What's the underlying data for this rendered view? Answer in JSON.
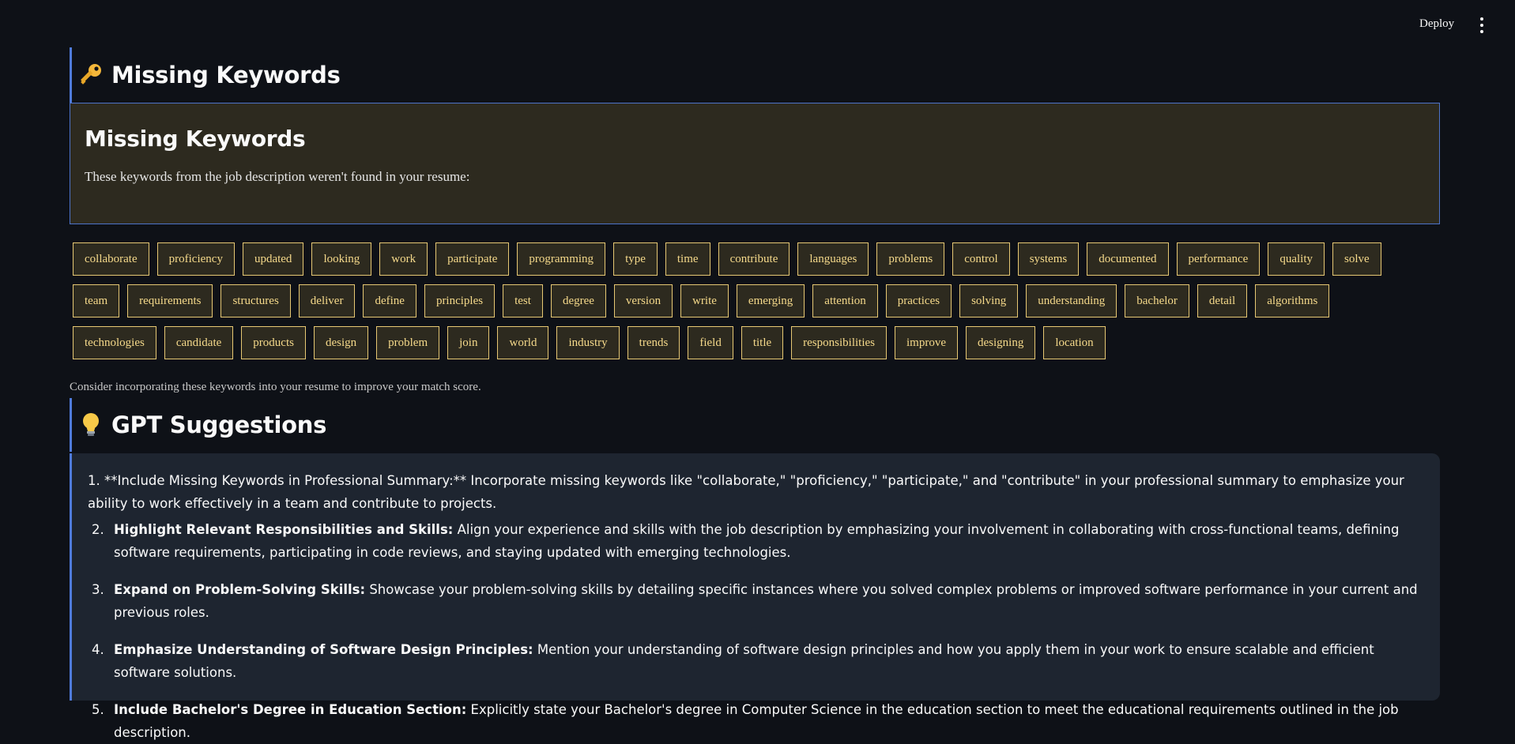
{
  "topbar": {
    "deploy_label": "Deploy",
    "menu_icon": "vertical-dots-icon"
  },
  "missing_section": {
    "emoji": "key-icon",
    "heading": "Missing Keywords",
    "box_title": "Missing Keywords",
    "box_text": "These keywords from the job description weren't found in your resume:",
    "keywords": [
      "collaborate",
      "proficiency",
      "updated",
      "looking",
      "work",
      "participate",
      "programming",
      "type",
      "time",
      "contribute",
      "languages",
      "problems",
      "control",
      "systems",
      "documented",
      "performance",
      "quality",
      "solve",
      "team",
      "requirements",
      "structures",
      "deliver",
      "define",
      "principles",
      "test",
      "degree",
      "version",
      "write",
      "emerging",
      "attention",
      "practices",
      "solving",
      "understanding",
      "bachelor",
      "detail",
      "algorithms",
      "technologies",
      "candidate",
      "products",
      "design",
      "problem",
      "join",
      "world",
      "industry",
      "trends",
      "field",
      "title",
      "responsibilities",
      "improve",
      "designing",
      "location"
    ],
    "footer": "Consider incorporating these keywords into your resume to improve your match score."
  },
  "gpt_section": {
    "emoji": "lightbulb-icon",
    "heading": "GPT Suggestions",
    "first": "1. **Include Missing Keywords in Professional Summary:** Incorporate missing keywords like \"collaborate,\" \"proficiency,\" \"participate,\" and \"contribute\" in your professional summary to emphasize your ability to work effectively in a team and contribute to projects.",
    "items": [
      {
        "num": "2.",
        "title": "Highlight Relevant Responsibilities and Skills:",
        "text": " Align your experience and skills with the job description by emphasizing your involvement in collaborating with cross-functional teams, defining software requirements, participating in code reviews, and staying updated with emerging technologies."
      },
      {
        "num": "3.",
        "title": "Expand on Problem-Solving Skills:",
        "text": " Showcase your problem-solving skills by detailing specific instances where you solved complex problems or improved software performance in your current and previous roles."
      },
      {
        "num": "4.",
        "title": "Emphasize Understanding of Software Design Principles:",
        "text": " Mention your understanding of software design principles and how you apply them in your work to ensure scalable and efficient software solutions."
      },
      {
        "num": "5.",
        "title": "Include Bachelor's Degree in Education Section:",
        "text": " Explicitly state your Bachelor's degree in Computer Science in the education section to meet the educational requirements outlined in the job description."
      }
    ]
  }
}
